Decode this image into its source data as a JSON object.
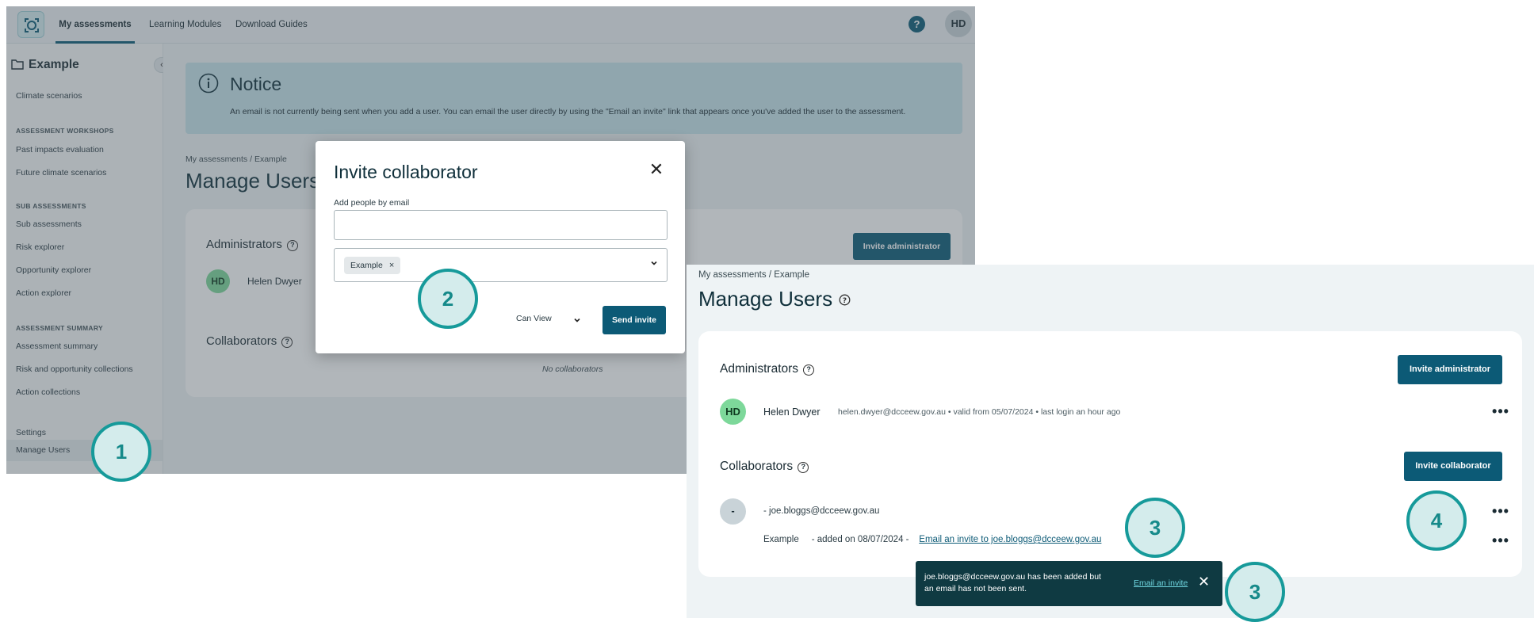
{
  "top_nav": {
    "tabs": [
      "My assessments",
      "Learning Modules",
      "Download Guides"
    ],
    "help_label": "?",
    "user_initials": "HD"
  },
  "sidebar": {
    "project_title": "Example",
    "collapse_label": "‹",
    "items": [
      {
        "label": "Climate scenarios"
      },
      {
        "heading": "ASSESSMENT WORKSHOPS"
      },
      {
        "label": "Past impacts evaluation"
      },
      {
        "label": "Future climate scenarios"
      },
      {
        "heading": "SUB ASSESSMENTS"
      },
      {
        "label": "Sub assessments"
      },
      {
        "label": "Risk explorer"
      },
      {
        "label": "Opportunity explorer"
      },
      {
        "label": "Action explorer"
      },
      {
        "heading": "ASSESSMENT SUMMARY"
      },
      {
        "label": "Assessment summary"
      },
      {
        "label": "Risk and opportunity collections"
      },
      {
        "label": "Action collections"
      },
      {
        "label": "Settings"
      },
      {
        "label": "Manage Users",
        "active": true
      }
    ]
  },
  "notice": {
    "title": "Notice",
    "text": "An email is not currently being sent when you add a user.  You can email the user directly by using the \"Email an invite\" link that appears once you've added the user to the assessment."
  },
  "page": {
    "breadcrumb": "My assessments  /  Example",
    "title": "Manage Users",
    "admins_heading": "Administrators",
    "collab_heading": "Collaborators",
    "invite_admin_label": "Invite administrator",
    "invite_collab_label": "Invite collaborator",
    "no_collaborators": "No collaborators",
    "admin_user": {
      "initials": "HD",
      "name": "Helen Dwyer",
      "meta": "helen.dwyer@dcceew.gov.au  •  valid from 05/07/2024  •  last login an hour ago"
    },
    "collab_user": {
      "initials": "-",
      "line1": "-     joe.bloggs@dcceew.gov.au",
      "assessment": "Example",
      "added": "-     added on 08/07/2024     -",
      "email_link": "Email an invite to joe.bloggs@dcceew.gov.au"
    },
    "more_label": "•••"
  },
  "modal": {
    "title": "Invite collaborator",
    "close_label": "✕",
    "email_label": "Add people by email",
    "email_value": "",
    "chip_label": "Example",
    "chip_remove": "×",
    "permission": "Can View",
    "send_label": "Send invite"
  },
  "toast": {
    "message": "joe.bloggs@dcceew.gov.au has been added but an email has not been sent.",
    "link": "Email an invite",
    "close_label": "✕"
  },
  "steps": [
    "1",
    "2",
    "3",
    "3",
    "4"
  ],
  "colors": {
    "primary": "#0c5a76",
    "notice_bg": "#c7e3ea",
    "step_ring": "#169a9a",
    "avatar_green": "#7dd89a",
    "toast_bg": "#0f3a42"
  }
}
